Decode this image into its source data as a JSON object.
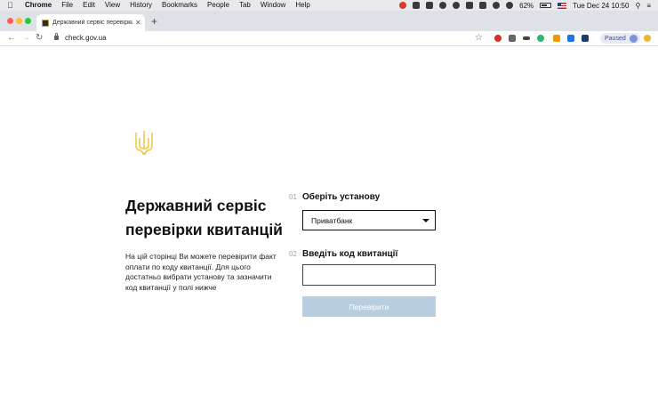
{
  "menubar": {
    "app": "Chrome",
    "items": [
      "File",
      "Edit",
      "View",
      "History",
      "Bookmarks",
      "People",
      "Tab",
      "Window",
      "Help"
    ],
    "battery": "62%",
    "datetime": "Tue Dec 24  10:50"
  },
  "browser": {
    "tab_title": "Державний сервіс перевірки",
    "url": "check.gov.ua",
    "profile_status": "Paused"
  },
  "page": {
    "heading": "Державний сервіс перевірки квитанцій",
    "description": "На цій сторінці Ви можете перевірити факт оплати по коду квитанції. Для цього достатньо вибрати установу та зазначити код квитанції у полі нижче",
    "step1": {
      "num": "01",
      "label": "Оберіть установу",
      "selected": "Приватбанк"
    },
    "step2": {
      "num": "02",
      "label": "Введіть код квитанції",
      "value": ""
    },
    "submit_label": "Перевірити"
  },
  "colors": {
    "accent_button": "#b8cde0",
    "trident": "#f2c94c"
  }
}
